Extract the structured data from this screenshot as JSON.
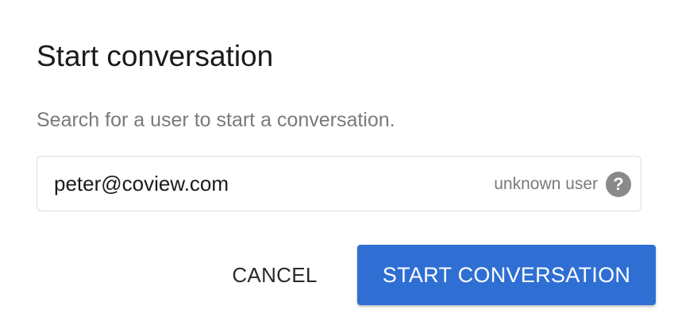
{
  "dialog": {
    "title": "Start conversation",
    "subtitle": "Search for a user to start a conversation."
  },
  "search": {
    "value": "peter@coview.com",
    "status_text": "unknown user",
    "help_icon": "question-mark-circle-icon",
    "help_glyph": "?"
  },
  "actions": {
    "cancel_label": "CANCEL",
    "start_label": "START CONVERSATION"
  },
  "colors": {
    "primary": "#2f6fd4",
    "muted_text": "#7a7a7a",
    "icon_bg": "#8a8a8a",
    "border": "#dddddd"
  }
}
